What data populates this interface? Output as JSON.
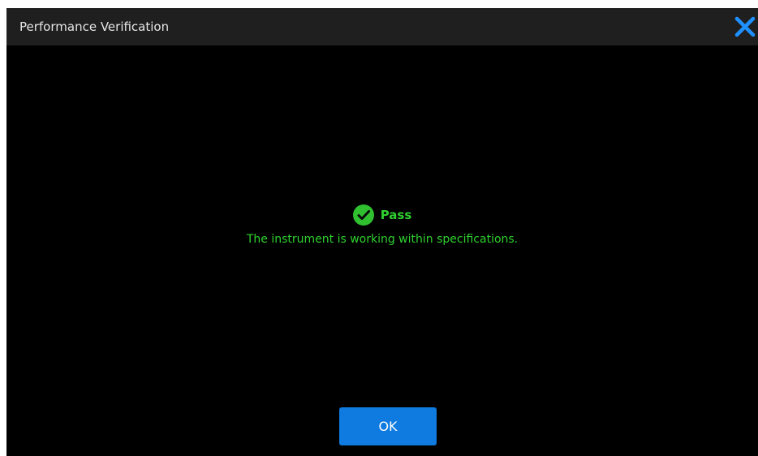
{
  "window": {
    "title": "Performance Verification",
    "close_icon": "close-icon"
  },
  "result": {
    "status": "Pass",
    "status_icon": "check-circle-icon",
    "message": "The instrument is working within specifications.",
    "color": "#2fd02f"
  },
  "actions": {
    "ok_label": "OK",
    "ok_color": "#0f7ae0"
  }
}
